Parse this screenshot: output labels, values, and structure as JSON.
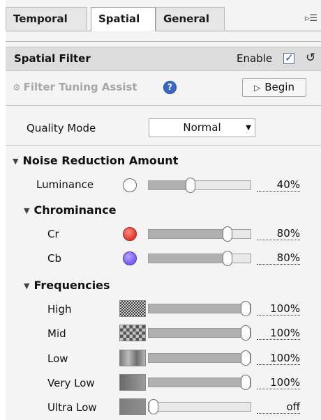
{
  "tabs": [
    {
      "label": "Temporal",
      "active": false
    },
    {
      "label": "Spatial",
      "active": true
    },
    {
      "label": "General",
      "active": false
    }
  ],
  "tab_overflow_icon": "panel-menu-icon",
  "section": {
    "title": "Spatial Filter",
    "enable_label": "Enable",
    "enabled": true,
    "reset_icon": "reset-icon"
  },
  "assist": {
    "label": "Filter Tuning Assist",
    "help_glyph": "?",
    "begin_label": "Begin"
  },
  "quality": {
    "label": "Quality Mode",
    "value": "Normal"
  },
  "noise_reduction": {
    "title": "Noise Reduction Amount",
    "luminance": {
      "label": "Luminance",
      "value": "40%",
      "level": 0.4
    }
  },
  "chrominance": {
    "title": "Chrominance",
    "rows": [
      {
        "label": "Cr",
        "value": "80%",
        "level": 0.8,
        "color": "#e13a30"
      },
      {
        "label": "Cb",
        "value": "80%",
        "level": 0.8,
        "color": "#7a5ef2"
      }
    ]
  },
  "frequencies": {
    "title": "Frequencies",
    "rows": [
      {
        "label": "High",
        "value": "100%",
        "level": 1.0
      },
      {
        "label": "Mid",
        "value": "100%",
        "level": 1.0
      },
      {
        "label": "Low",
        "value": "100%",
        "level": 1.0
      },
      {
        "label": "Very Low",
        "value": "100%",
        "level": 1.0
      },
      {
        "label": "Ultra Low",
        "value": "off",
        "level": 0.0
      }
    ]
  },
  "colors": {
    "panel_bg": "#f4f4f4",
    "header_bg": "#dcdcdc",
    "accent": "#3b68c6"
  }
}
